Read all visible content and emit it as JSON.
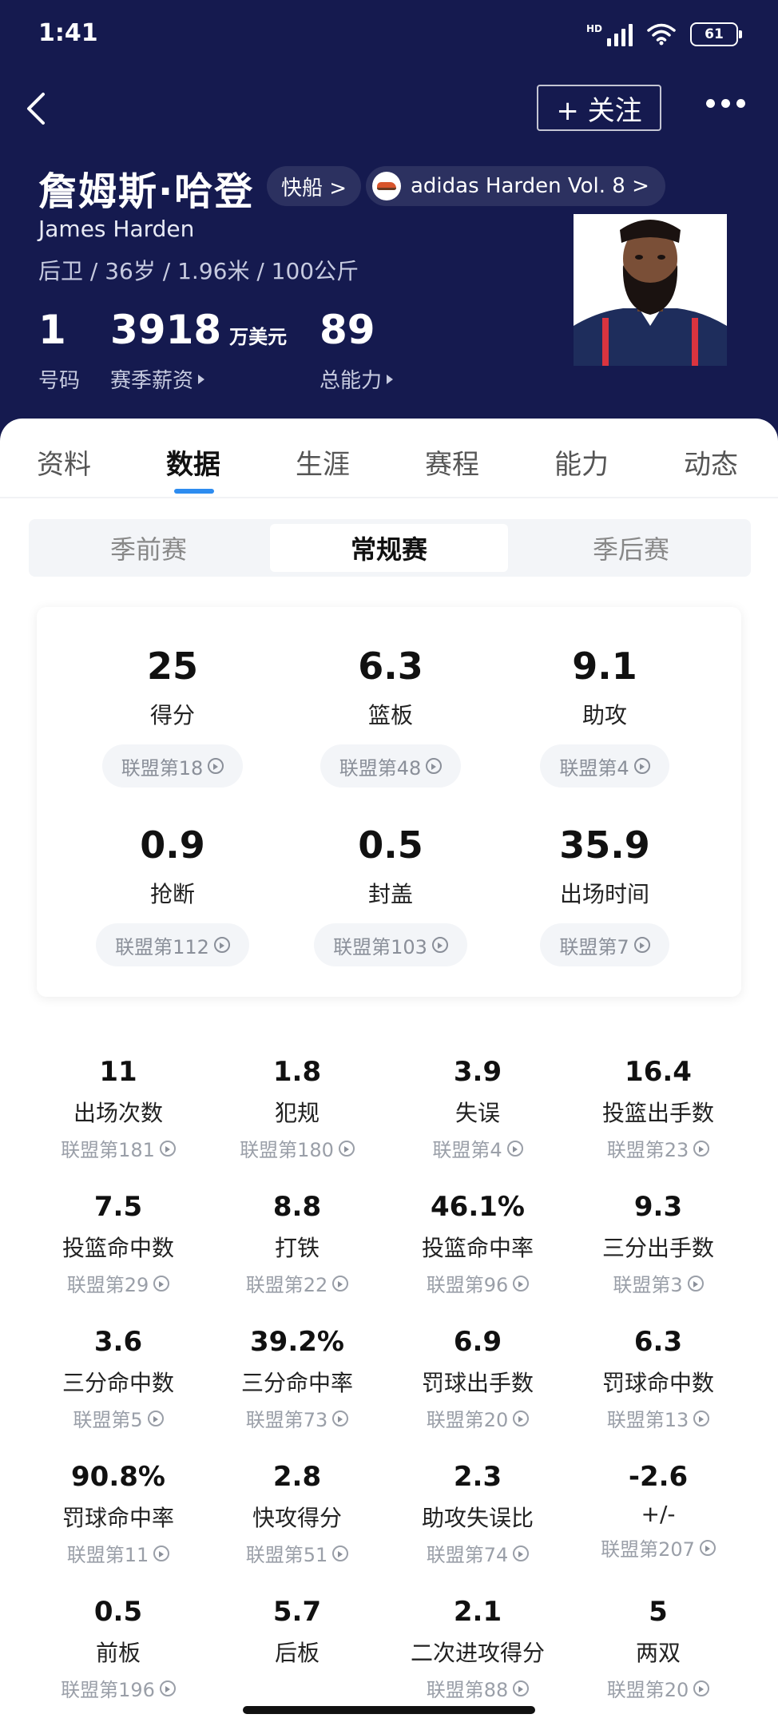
{
  "status": {
    "time": "1:41",
    "network": "HD",
    "battery": "61"
  },
  "nav": {
    "follow_label": "+ 关注"
  },
  "player": {
    "name_cn": "詹姆斯·哈登",
    "team": "快船 >",
    "shoe": "adidas Harden Vol. 8 >",
    "name_en": "James Harden",
    "bio": "后卫 / 36岁 / 1.96米 / 100公斤",
    "number": {
      "value": "1",
      "label": "号码"
    },
    "salary": {
      "value": "3918",
      "unit": "万美元",
      "label": "赛季薪资"
    },
    "rating": {
      "value": "89",
      "label": "总能力"
    }
  },
  "tabs": [
    "资料",
    "数据",
    "生涯",
    "赛程",
    "能力",
    "动态"
  ],
  "season_tabs": [
    "季前赛",
    "常规赛",
    "季后赛"
  ],
  "main_stats": [
    {
      "value": "25",
      "label": "得分",
      "rank": "联盟第18"
    },
    {
      "value": "6.3",
      "label": "篮板",
      "rank": "联盟第48"
    },
    {
      "value": "9.1",
      "label": "助攻",
      "rank": "联盟第4"
    },
    {
      "value": "0.9",
      "label": "抢断",
      "rank": "联盟第112"
    },
    {
      "value": "0.5",
      "label": "封盖",
      "rank": "联盟第103"
    },
    {
      "value": "35.9",
      "label": "出场时间",
      "rank": "联盟第7"
    }
  ],
  "detail_stats": [
    {
      "value": "11",
      "label": "出场次数",
      "rank": "联盟第181"
    },
    {
      "value": "1.8",
      "label": "犯规",
      "rank": "联盟第180"
    },
    {
      "value": "3.9",
      "label": "失误",
      "rank": "联盟第4"
    },
    {
      "value": "16.4",
      "label": "投篮出手数",
      "rank": "联盟第23"
    },
    {
      "value": "7.5",
      "label": "投篮命中数",
      "rank": "联盟第29"
    },
    {
      "value": "8.8",
      "label": "打铁",
      "rank": "联盟第22"
    },
    {
      "value": "46.1%",
      "label": "投篮命中率",
      "rank": "联盟第96"
    },
    {
      "value": "9.3",
      "label": "三分出手数",
      "rank": "联盟第3"
    },
    {
      "value": "3.6",
      "label": "三分命中数",
      "rank": "联盟第5"
    },
    {
      "value": "39.2%",
      "label": "三分命中率",
      "rank": "联盟第73"
    },
    {
      "value": "6.9",
      "label": "罚球出手数",
      "rank": "联盟第20"
    },
    {
      "value": "6.3",
      "label": "罚球命中数",
      "rank": "联盟第13"
    },
    {
      "value": "90.8%",
      "label": "罚球命中率",
      "rank": "联盟第11"
    },
    {
      "value": "2.8",
      "label": "快攻得分",
      "rank": "联盟第51"
    },
    {
      "value": "2.3",
      "label": "助攻失误比",
      "rank": "联盟第74"
    },
    {
      "value": "-2.6",
      "label": "+/-",
      "rank": "联盟第207"
    },
    {
      "value": "0.5",
      "label": "前板",
      "rank": "联盟第196"
    },
    {
      "value": "5.7",
      "label": "后板",
      "rank": ""
    },
    {
      "value": "2.1",
      "label": "二次进攻得分",
      "rank": "联盟第88"
    },
    {
      "value": "5",
      "label": "两双",
      "rank": "联盟第20"
    }
  ],
  "colors": {
    "header_bg": "#151a4f",
    "accent": "#2d8cf0"
  }
}
